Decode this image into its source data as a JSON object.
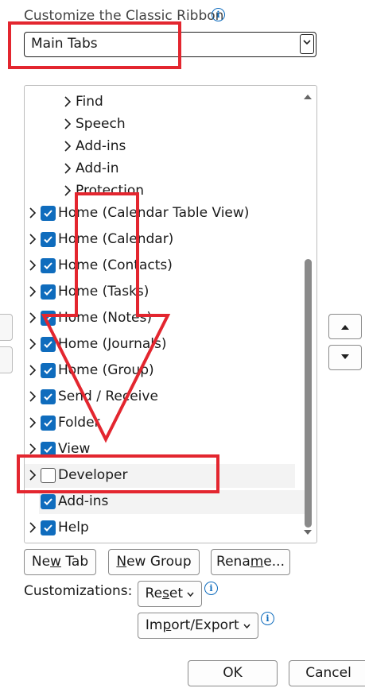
{
  "header": {
    "title": "Customize the Classic Ribbon"
  },
  "combo": {
    "value": "Main Tabs",
    "arrow": "⌵"
  },
  "tree": {
    "children": [
      {
        "label": "Find"
      },
      {
        "label": "Speech"
      },
      {
        "label": "Add-ins"
      },
      {
        "label": "Add-in"
      },
      {
        "label": "Protection"
      }
    ],
    "tabs": [
      {
        "label": "Home (Calendar Table View)",
        "checked": true
      },
      {
        "label": "Home (Calendar)",
        "checked": true
      },
      {
        "label": "Home (Contacts)",
        "checked": true
      },
      {
        "label": "Home (Tasks)",
        "checked": true
      },
      {
        "label": "Home (Notes)",
        "checked": true
      },
      {
        "label": "Home (Journals)",
        "checked": true
      },
      {
        "label": "Home (Group)",
        "checked": true
      },
      {
        "label": "Send / Receive",
        "checked": true
      },
      {
        "label": "Folder",
        "checked": true
      },
      {
        "label": "View",
        "checked": true
      },
      {
        "label": "Developer",
        "checked": false
      },
      {
        "label": "Add-ins",
        "checked": true
      },
      {
        "label": "Help",
        "checked": true
      }
    ]
  },
  "buttons": {
    "new_tab_pre": "Ne",
    "new_tab_u": "w",
    "new_tab_post": " Tab",
    "new_group_pre": "",
    "new_group_u": "N",
    "new_group_post": "ew Group",
    "rename_pre": "Rena",
    "rename_u": "m",
    "rename_post": "e...",
    "customizations_label": "Customizations:",
    "reset_pre": "Re",
    "reset_u": "s",
    "reset_post": "et",
    "import_pre": "Im",
    "import_u": "p",
    "import_post": "ort/Export",
    "ok": "OK",
    "cancel": "Cancel"
  },
  "colors": {
    "accent": "#0f6cbd",
    "annotation": "#e3262f"
  }
}
